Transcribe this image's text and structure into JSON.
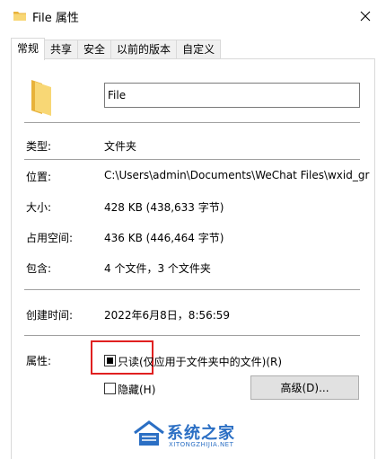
{
  "window": {
    "title": "File 属性",
    "close_icon": "close-icon"
  },
  "tabs": [
    {
      "label": "常规",
      "active": true
    },
    {
      "label": "共享",
      "active": false
    },
    {
      "label": "安全",
      "active": false
    },
    {
      "label": "以前的版本",
      "active": false
    },
    {
      "label": "自定义",
      "active": false
    }
  ],
  "general": {
    "name_value": "File",
    "folder_icon": "folder-icon",
    "type": {
      "label": "类型:",
      "value": "文件夹"
    },
    "location": {
      "label": "位置:",
      "value": "C:\\Users\\admin\\Documents\\WeChat Files\\wxid_gr"
    },
    "size": {
      "label": "大小:",
      "value": "428 KB (438,633 字节)"
    },
    "size_on_disk": {
      "label": "占用空间:",
      "value": "436 KB (446,464 字节)"
    },
    "contains": {
      "label": "包含:",
      "value": "4 个文件，3 个文件夹"
    },
    "created": {
      "label": "创建时间:",
      "value": "2022年6月8日，8:56:59"
    },
    "attributes": {
      "label": "属性:",
      "readonly_label": "只读(仅应用于文件夹中的文件)(R)",
      "readonly_state": "mixed",
      "hidden_label": "隐藏(H)",
      "hidden_checked": false,
      "advanced_button": "高级(D)..."
    }
  },
  "watermark": {
    "text": "系统之家",
    "url": "XITONGZHIJIA.NET"
  },
  "colors": {
    "highlight": "#e02020",
    "folder": "#f8d775",
    "watermark": "#2b6fc4"
  }
}
